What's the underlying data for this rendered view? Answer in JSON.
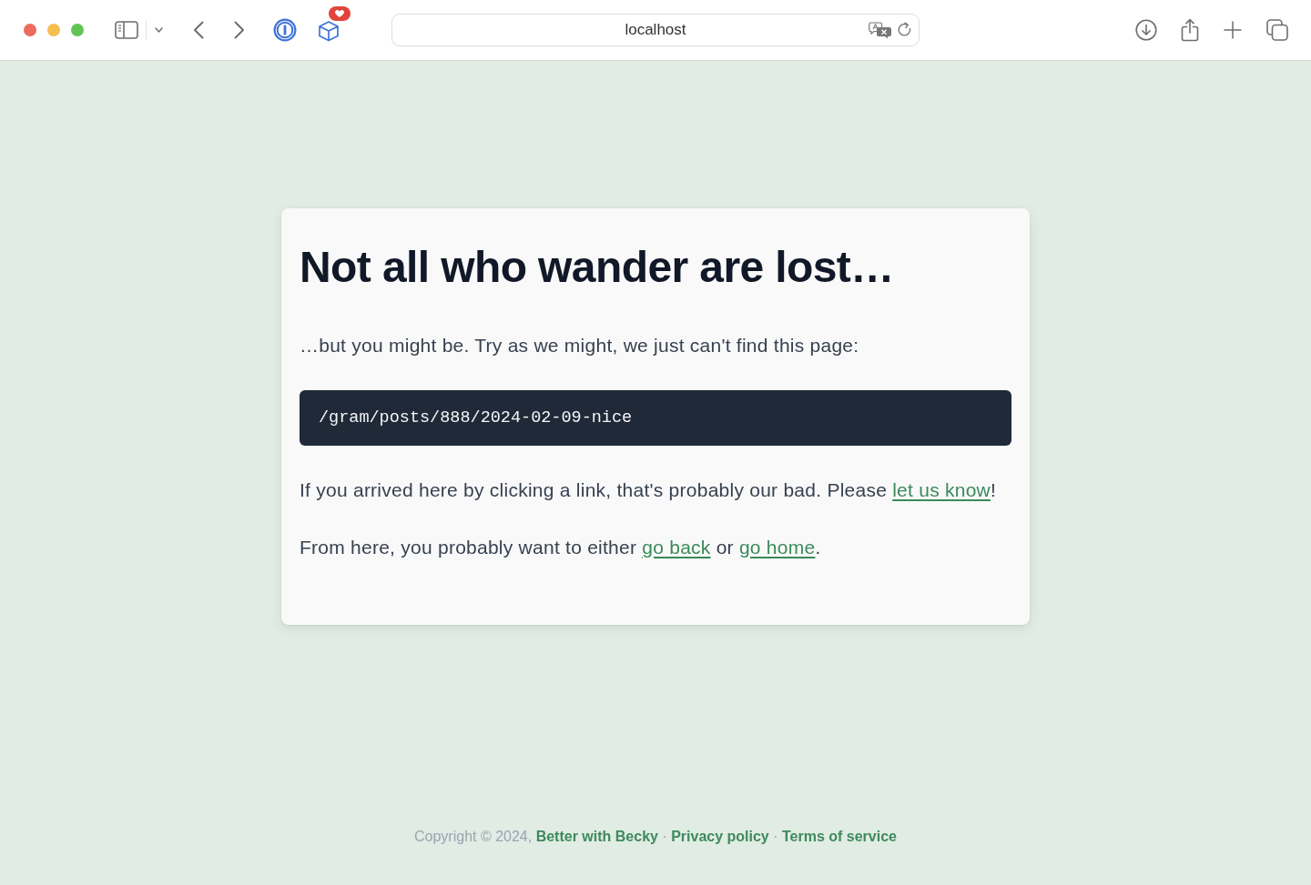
{
  "browser": {
    "window_controls": [
      {
        "color": "#ed6a5e"
      },
      {
        "color": "#f5bf4f"
      },
      {
        "color": "#61c554"
      }
    ],
    "address_bar": {
      "value": "localhost"
    }
  },
  "card": {
    "heading": "Not all who wander are lost…",
    "blocks": [
      {
        "kind": "paragraph",
        "segments": [
          {
            "kind": "text",
            "text": "…but you might be. Try as we might, we just can't find this page:"
          }
        ]
      },
      {
        "kind": "code",
        "text": "/gram/posts/888/2024-02-09-nice"
      },
      {
        "kind": "paragraph",
        "segments": [
          {
            "kind": "text",
            "text": "If you arrived here by clicking a link, that's probably our bad. Please "
          },
          {
            "kind": "link",
            "text": "let us know"
          },
          {
            "kind": "text",
            "text": "!"
          }
        ]
      },
      {
        "kind": "paragraph",
        "segments": [
          {
            "kind": "text",
            "text": "From here, you probably want to either "
          },
          {
            "kind": "link",
            "text": "go back"
          },
          {
            "kind": "text",
            "text": " or "
          },
          {
            "kind": "link",
            "text": "go home"
          },
          {
            "kind": "text",
            "text": "."
          }
        ]
      }
    ]
  },
  "footer": {
    "segments": [
      {
        "kind": "text",
        "text": "Copyright © 2024, "
      },
      {
        "kind": "link",
        "text": "Better with Becky"
      },
      {
        "kind": "text",
        "text": " · "
      },
      {
        "kind": "link",
        "text": "Privacy policy"
      },
      {
        "kind": "text",
        "text": " · "
      },
      {
        "kind": "link",
        "text": "Terms of service"
      }
    ]
  }
}
